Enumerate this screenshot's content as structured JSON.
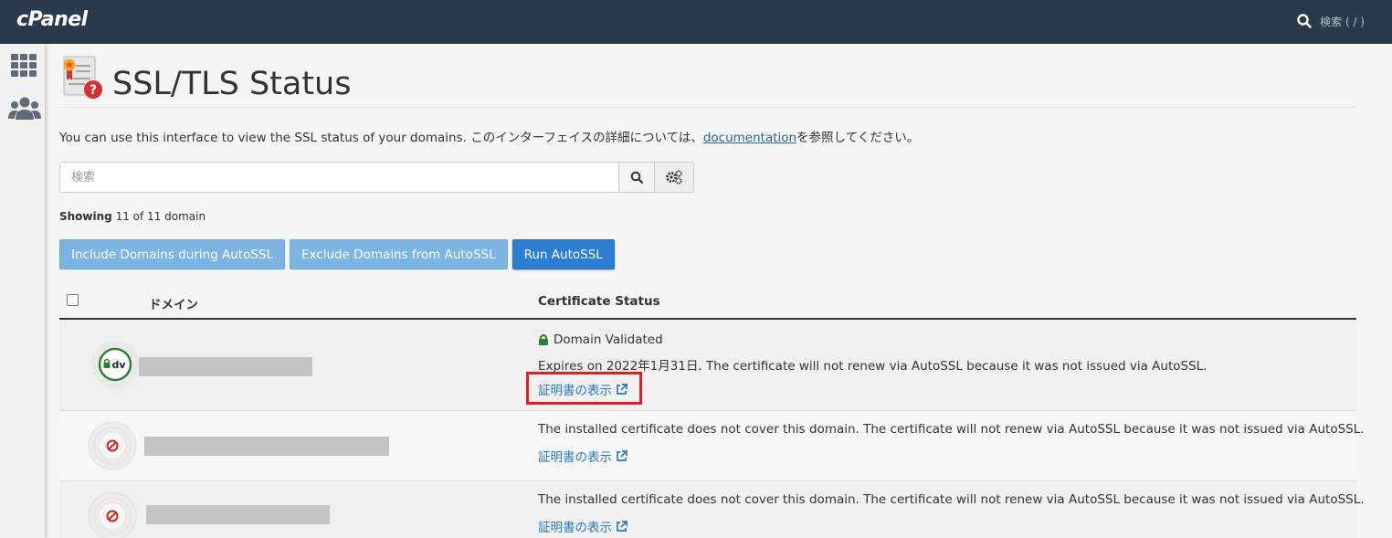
{
  "topbar": {
    "logo": "cPanel",
    "search_label": "検索 ( / )"
  },
  "sidebar": {
    "items": [
      {
        "name": "apps-grid"
      },
      {
        "name": "users"
      }
    ]
  },
  "page": {
    "title": "SSL/TLS Status",
    "intro_text": "You can use this interface to view the SSL status of your domains. このインターフェイスの詳細については、",
    "intro_link": "documentation",
    "intro_suffix": "を参照してください。"
  },
  "search": {
    "placeholder": "検索"
  },
  "showing": {
    "label": "Showing",
    "count_text": "11 of 11 domain"
  },
  "buttons": {
    "include": "Include Domains during AutoSSL",
    "exclude": "Exclude Domains from AutoSSL",
    "run": "Run AutoSSL"
  },
  "table": {
    "headers": {
      "domain": "ドメイン",
      "status": "Certificate Status"
    },
    "rows": [
      {
        "badge": "dv",
        "status_title": "Domain Validated",
        "status_text": "Expires on 2022年1月31日. The certificate will not renew via AutoSSL because it was not issued via AutoSSL.",
        "link": "証明書の表示"
      },
      {
        "badge": "none",
        "status_text": "The installed certificate does not cover this domain. The certificate will not renew via AutoSSL because it was not issued via AutoSSL.",
        "link": "証明書の表示"
      },
      {
        "badge": "none",
        "status_text": "The installed certificate does not cover this domain. The certificate will not renew via AutoSSL because it was not issued via AutoSSL.",
        "link": "証明書の表示"
      }
    ]
  },
  "colors": {
    "topbar": "#293a4a",
    "link": "#2a7ab9",
    "primary_button": "#2d7dd2",
    "light_button": "#7cb4e3",
    "dv_green": "#2e7d32",
    "error_red": "#c62828",
    "highlight": "#d9222a"
  }
}
